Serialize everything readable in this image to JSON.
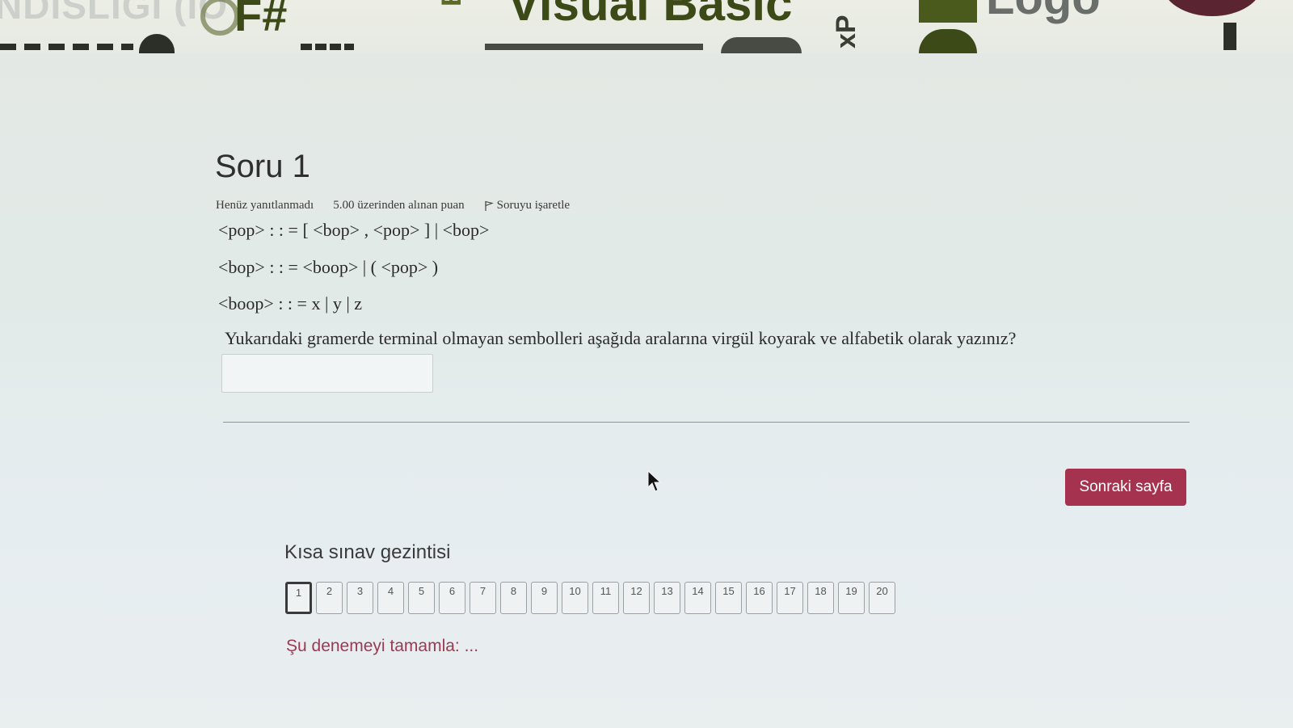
{
  "banner": {
    "words": [
      "NDISLIGI (IO",
      "F#",
      "Visual Basic",
      "Logo",
      "Ed",
      "xP"
    ]
  },
  "question": {
    "title": "Soru 1",
    "status": "Henüz yanıtlanmadı",
    "points": "5.00 üzerinden alınan puan",
    "flag_label": "Soruyu işaretle",
    "grammar": [
      "<pop> : : = [ <bop> , <pop> ] | <bop>",
      "<bop> : : = <boop> | ( <pop> )",
      "<boop> : : = x | y | z"
    ],
    "prompt": "Yukarıdaki gramerde terminal olmayan sembolleri aşağıda aralarına virgül koyarak ve alfabetik olarak yazınız?",
    "answer_value": ""
  },
  "actions": {
    "next_label": "Sonraki sayfa"
  },
  "quiz_nav": {
    "title": "Kısa sınav gezintisi",
    "current": 1,
    "items": [
      "1",
      "2",
      "3",
      "4",
      "5",
      "6",
      "7",
      "8",
      "9",
      "10",
      "11",
      "12",
      "13",
      "14",
      "15",
      "16",
      "17",
      "18",
      "19",
      "20"
    ],
    "finish_label": "Şu denemeyi tamamla: ..."
  },
  "colors": {
    "accent": "#a5334f",
    "link": "#9a3a52",
    "banner_green": "#3c4a18"
  },
  "icons": [
    "flag-icon",
    "mouse-cursor-icon"
  ]
}
